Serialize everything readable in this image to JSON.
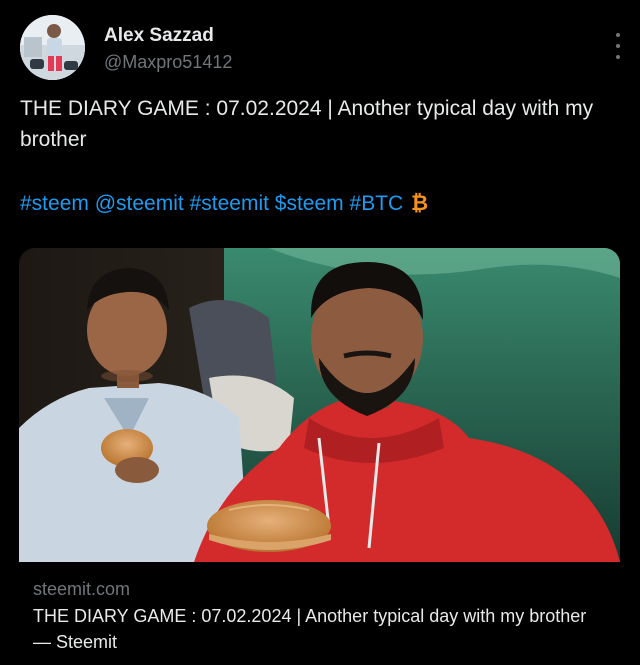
{
  "author": {
    "display_name": "Alex Sazzad",
    "handle": "@Maxpro51412"
  },
  "tweet": {
    "text": "THE DIARY GAME : 07.02.2024 | Another typical day with my brother",
    "tags": [
      "#steem",
      "@steemit",
      "#steemit",
      "$steem",
      "#BTC"
    ],
    "btc_glyph": "₿"
  },
  "card": {
    "domain": "steemit.com",
    "title": "THE DIARY GAME : 07.02.2024 | Another typical day with my brother — Steemit"
  },
  "icons": {
    "more": "more-vertical-icon",
    "btc": "bitcoin-icon"
  },
  "colors": {
    "background": "#000000",
    "text": "#e7e9ea",
    "secondary": "#71767b",
    "link": "#1d9bf0",
    "bitcoin": "#f7931a"
  }
}
